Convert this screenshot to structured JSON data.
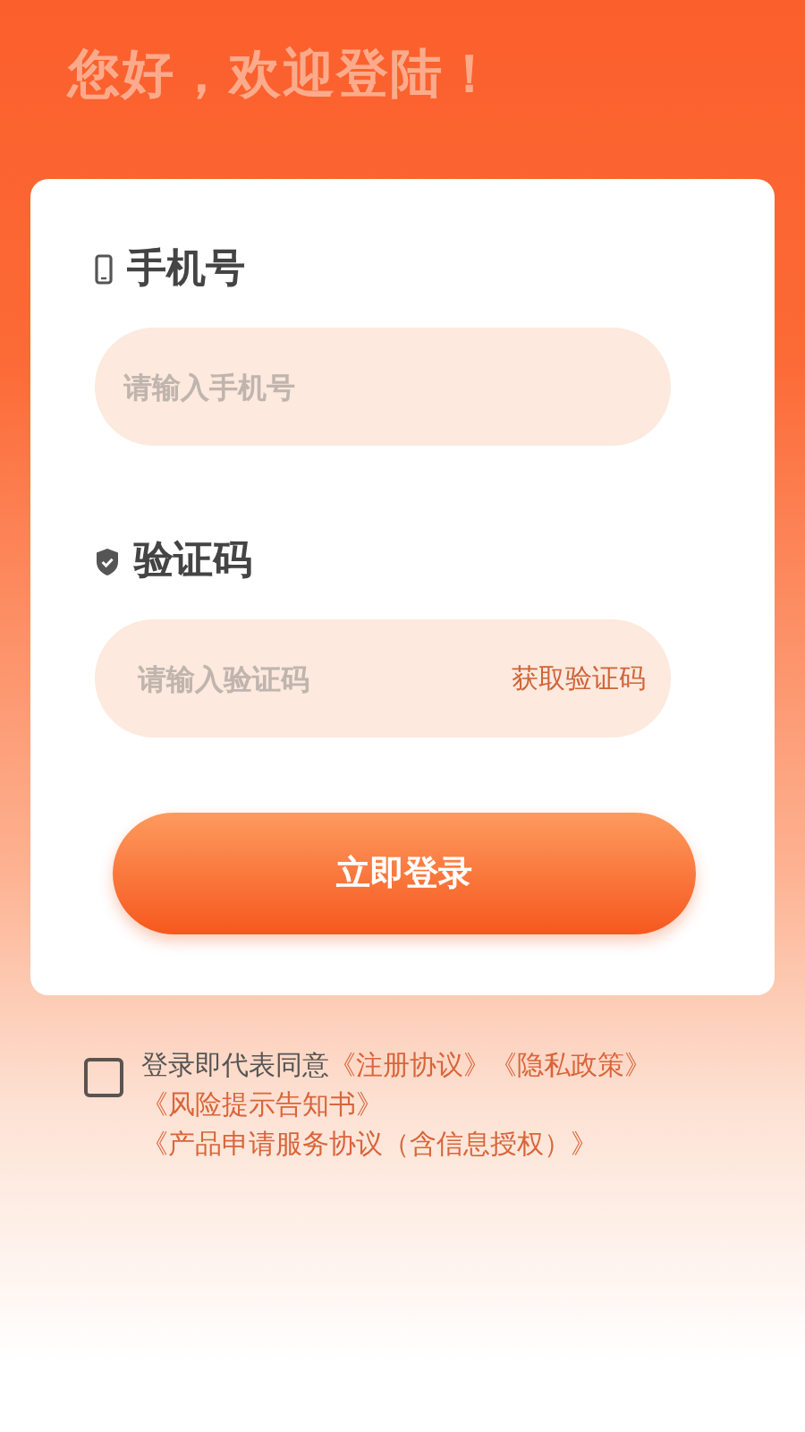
{
  "greeting": "您好，欢迎登陆！",
  "fields": [
    {
      "kind": "phone",
      "label": "手机号",
      "placeholder": "请输入手机号"
    },
    {
      "kind": "code",
      "label": "验证码",
      "placeholder": "请输入验证码",
      "action": "获取验证码"
    }
  ],
  "login_button": "立即登录",
  "agreement": {
    "checked": false,
    "parts": [
      {
        "kind": "text",
        "text": "登录即代表同意"
      },
      {
        "kind": "link",
        "text": "《注册协议》"
      },
      {
        "kind": "link",
        "text": "《隐私政策》"
      },
      {
        "kind": "link",
        "text": "《风险提示告知书》"
      },
      {
        "kind": "link",
        "text": "《产品申请服务协议（含信息授权）》"
      }
    ]
  }
}
